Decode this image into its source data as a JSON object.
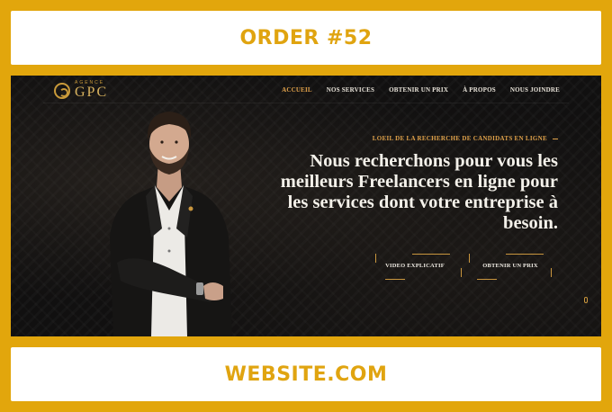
{
  "header_banner": {
    "text": "ORDER #52"
  },
  "footer_banner": {
    "text": "WEBSITE.COM"
  },
  "site": {
    "logo": {
      "sub": "AGENCE",
      "name": "GPC"
    },
    "nav": [
      {
        "label": "ACCUEIL",
        "active": true
      },
      {
        "label": "NOS SERVICES",
        "active": false
      },
      {
        "label": "OBTENIR UN PRIX",
        "active": false
      },
      {
        "label": "À PROPOS",
        "active": false
      },
      {
        "label": "NOUS JOINDRE",
        "active": false
      }
    ],
    "hero": {
      "eyebrow": "LOEIL DE LA RECHERCHE DE CANDIDATS EN LIGNE",
      "headline": "Nous recherchons pour vous les meilleurs Freelancers en ligne pour les services dont votre entreprise à besoin.",
      "buttons": {
        "video": "VIDEO EXPLICATIF",
        "price": "OBTENIR UN PRIX"
      }
    }
  },
  "colors": {
    "frame": "#e2a60c",
    "banner_text": "#e0a410",
    "accent": "#e2a24a",
    "dark": "#111010"
  }
}
